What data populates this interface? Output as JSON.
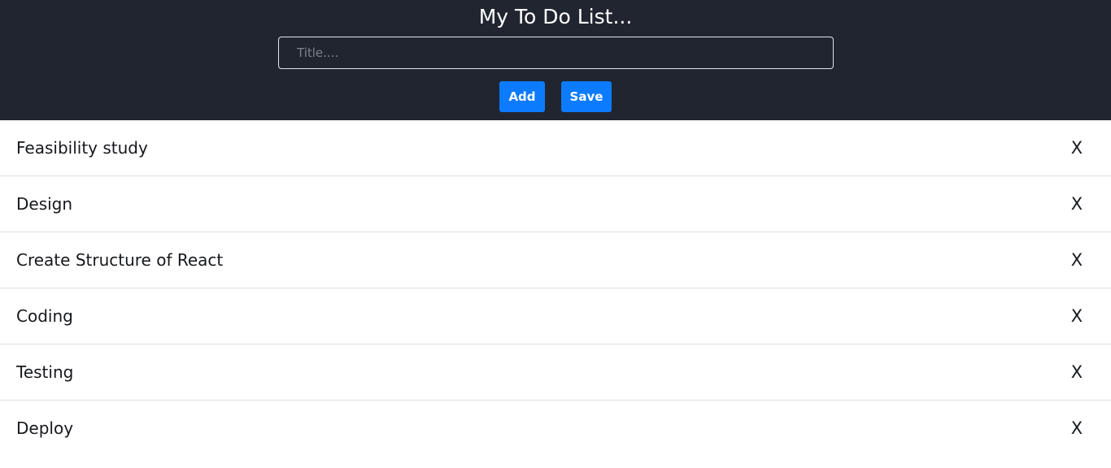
{
  "header": {
    "title": "My To Do List...",
    "title_input": {
      "value": "",
      "placeholder": "Title...."
    },
    "add_label": "Add",
    "save_label": "Save"
  },
  "items": [
    {
      "label": "Feasibility study",
      "delete_glyph": "X"
    },
    {
      "label": "Design",
      "delete_glyph": "X"
    },
    {
      "label": "Create Structure of React",
      "delete_glyph": "X"
    },
    {
      "label": "Coding",
      "delete_glyph": "X"
    },
    {
      "label": "Testing",
      "delete_glyph": "X"
    },
    {
      "label": "Deploy",
      "delete_glyph": "X"
    }
  ],
  "colors": {
    "header_bg": "#212530",
    "accent": "#0d7bfe",
    "text": "#16181c",
    "divider": "#dcdfe3"
  }
}
